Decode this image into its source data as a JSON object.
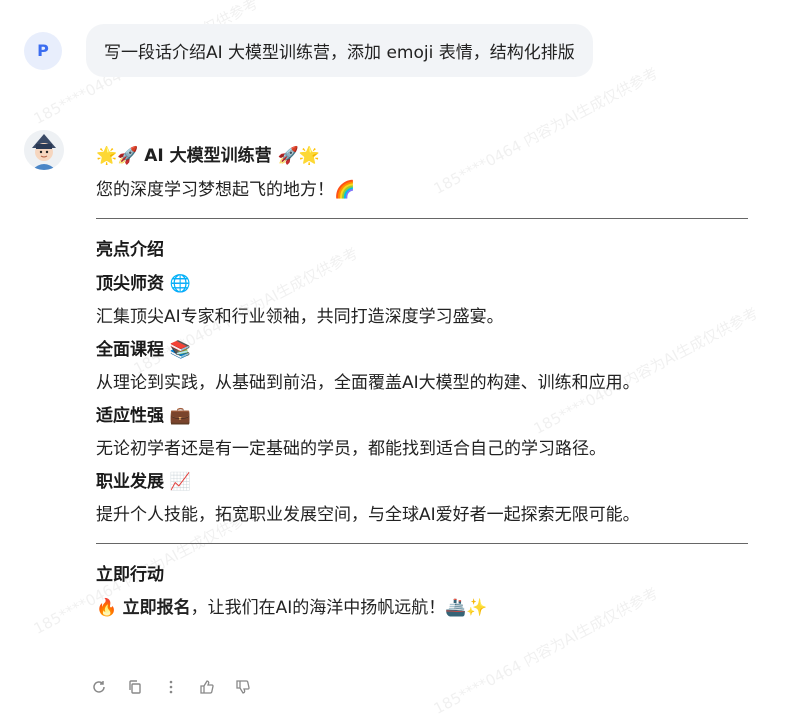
{
  "user": {
    "avatar_letter": "P",
    "message": "写一段话介绍AI 大模型训练营，添加 emoji 表情，结构化排版"
  },
  "bot": {
    "title": "🌟🚀 AI 大模型训练营 🚀🌟",
    "tagline": "您的深度学习梦想起飞的地方！🌈",
    "highlights_heading": "亮点介绍",
    "items": [
      {
        "heading": "顶尖师资 🌐",
        "text": "汇集顶尖AI专家和行业领袖，共同打造深度学习盛宴。"
      },
      {
        "heading": "全面课程 📚",
        "text": "从理论到实践，从基础到前沿，全面覆盖AI大模型的构建、训练和应用。"
      },
      {
        "heading": "适应性强 💼",
        "text": "无论初学者还是有一定基础的学员，都能找到适合自己的学习路径。"
      },
      {
        "heading": "职业发展 📈",
        "text": "提升个人技能，拓宽职业发展空间，与全球AI爱好者一起探索无限可能。"
      }
    ],
    "cta_heading": "立即行动",
    "cta_prefix": "🔥 ",
    "cta_bold": "立即报名",
    "cta_rest": "，让我们在AI的海洋中扬帆远航！🚢✨"
  },
  "watermark": "185****0464 内容为AI生成仅供参考",
  "icons": [
    "regenerate-icon",
    "copy-icon",
    "more-icon",
    "thumbs-up-icon",
    "thumbs-down-icon"
  ]
}
